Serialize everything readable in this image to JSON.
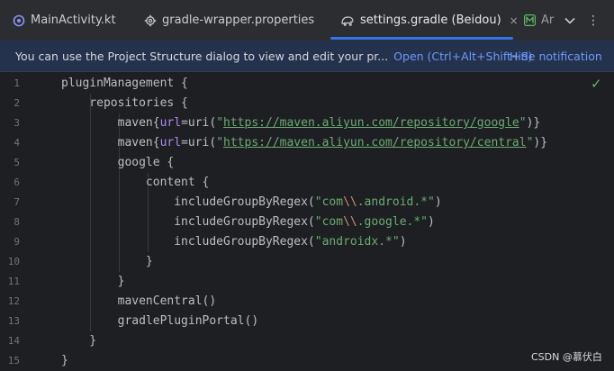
{
  "tabs": [
    {
      "label": "MainActivity.kt",
      "icon": "kotlin-file-icon"
    },
    {
      "label": "gradle-wrapper.properties",
      "icon": "gear-icon"
    },
    {
      "label": "settings.gradle (Beidou)",
      "icon": "gradle-elephant-icon",
      "active": true,
      "close": "×"
    },
    {
      "label": "Ar",
      "icon": "markdown-file-icon"
    }
  ],
  "tabbar_controls": {
    "dropdown": "⌄",
    "more": "⋮"
  },
  "notification": {
    "message": "You can use the Project Structure dialog to view and edit your pr...",
    "open_link": "Open (Ctrl+Alt+Shift+S)",
    "hide_link": "Hide notification"
  },
  "editor": {
    "line_numbers": [
      "1",
      "2",
      "3",
      "4",
      "5",
      "6",
      "7",
      "8",
      "9",
      "10",
      "11",
      "12",
      "13",
      "14",
      "15"
    ],
    "lines": [
      {
        "parts": [
          {
            "t": "pluginManagement {"
          }
        ]
      },
      {
        "parts": [
          {
            "t": "    repositories {"
          }
        ]
      },
      {
        "parts": [
          {
            "t": "        maven{"
          },
          {
            "t": "url",
            "k": "param"
          },
          {
            "t": "=uri("
          },
          {
            "t": "\"",
            "k": "str"
          },
          {
            "t": "https://maven.aliyun.com/repository/google",
            "k": "url"
          },
          {
            "t": "\"",
            "k": "str"
          },
          {
            "t": ")}"
          }
        ]
      },
      {
        "parts": [
          {
            "t": "        maven{"
          },
          {
            "t": "url",
            "k": "param"
          },
          {
            "t": "=uri("
          },
          {
            "t": "\"",
            "k": "str"
          },
          {
            "t": "https://maven.aliyun.com/repository/central",
            "k": "url"
          },
          {
            "t": "\"",
            "k": "str"
          },
          {
            "t": ")}"
          }
        ]
      },
      {
        "parts": [
          {
            "t": "        google {"
          }
        ]
      },
      {
        "parts": [
          {
            "t": "            content {"
          }
        ]
      },
      {
        "parts": [
          {
            "t": "                includeGroupByRegex("
          },
          {
            "t": "\"com",
            "k": "str"
          },
          {
            "t": "\\\\",
            "k": "esc"
          },
          {
            "t": ".android.*\"",
            "k": "str"
          },
          {
            "t": ")"
          }
        ]
      },
      {
        "parts": [
          {
            "t": "                includeGroupByRegex("
          },
          {
            "t": "\"com",
            "k": "str"
          },
          {
            "t": "\\\\",
            "k": "esc"
          },
          {
            "t": ".google.*\"",
            "k": "str"
          },
          {
            "t": ")"
          }
        ]
      },
      {
        "parts": [
          {
            "t": "                includeGroupByRegex("
          },
          {
            "t": "\"androidx.*\"",
            "k": "str"
          },
          {
            "t": ")"
          }
        ]
      },
      {
        "parts": [
          {
            "t": "            }"
          }
        ]
      },
      {
        "parts": [
          {
            "t": "        }"
          }
        ]
      },
      {
        "parts": [
          {
            "t": "        mavenCentral()"
          }
        ]
      },
      {
        "parts": [
          {
            "t": "        gradlePluginPortal()"
          }
        ]
      },
      {
        "parts": [
          {
            "t": "    }"
          }
        ]
      },
      {
        "parts": [
          {
            "t": "}"
          }
        ]
      }
    ],
    "inspection_status": "✓",
    "colors": {
      "string": "#6aab73",
      "param": "#b189f5",
      "escape": "#cf8e6d",
      "text": "#bcbec4",
      "accent": "#3574f0",
      "link": "#6b9bfa"
    }
  },
  "watermark": "CSDN @慕伏白"
}
